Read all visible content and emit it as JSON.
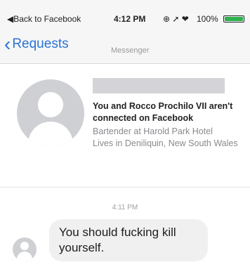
{
  "status_bar": {
    "back_label": "◀Back to Facebook",
    "time": "4:12 PM",
    "icons": "⊕ ➚ ❤",
    "battery_text": "100%",
    "battery_level_percent": 100,
    "battery_color": "#2bb24c"
  },
  "nav": {
    "back_label": "Requests",
    "subtitle": "Messenger",
    "accent_color": "#2a74d4"
  },
  "profile": {
    "not_connected_text": "You and Rocco Prochilo VII aren't connected on Facebook",
    "job": "Bartender at Harold Park Hotel",
    "location": "Lives in Deniliquin, New South Wales"
  },
  "conversation": {
    "timestamp": "4:11 PM",
    "messages": [
      {
        "text": "You should fucking kill yourself."
      }
    ]
  }
}
